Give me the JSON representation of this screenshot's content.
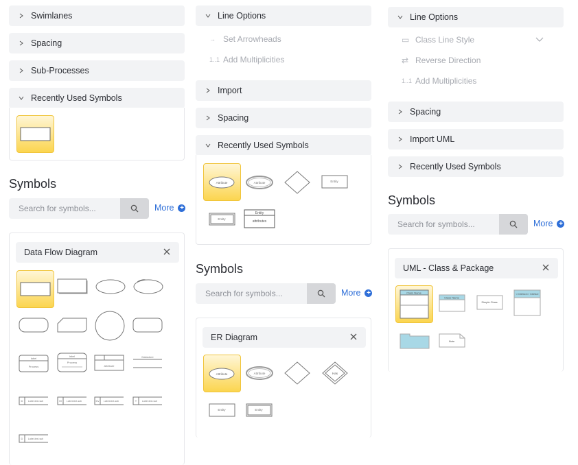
{
  "col1": {
    "sections": [
      "Swimlanes",
      "Spacing",
      "Sub-Processes",
      "Recently Used Symbols"
    ],
    "heading": "Symbols",
    "search_placeholder": "Search for symbols...",
    "more_label": "More",
    "library": "Data Flow Diagram",
    "shape_texts": {
      "label": "label",
      "process": "Process",
      "attribute": "Attribute",
      "datastore": "Datastore",
      "ids": [
        "D",
        "M",
        "T",
        "Dv",
        "D"
      ],
      "subtext": "Label-text-sub"
    }
  },
  "col2": {
    "line_options": "Line Options",
    "sub_items": [
      {
        "icon": "→",
        "label": "Set Arrowheads"
      },
      {
        "icon": "1..1",
        "label": "Add Multiplicities"
      }
    ],
    "sections": [
      "Import",
      "Spacing",
      "Recently Used Symbols"
    ],
    "recent_shape_texts": {
      "attribute": "Attribute",
      "entity": "Entity",
      "attributes": "attributes"
    },
    "heading": "Symbols",
    "search_placeholder": "Search for symbols...",
    "more_label": "More",
    "library": "ER Diagram",
    "er_shape_texts": {
      "attribute": "Attribute",
      "relationship": "Has",
      "entity": "Entity"
    }
  },
  "col3": {
    "line_options": "Line Options",
    "sub_items": [
      {
        "icon": "▭",
        "label": "Class Line Style"
      },
      {
        "icon": "⇄",
        "label": "Reverse Direction"
      },
      {
        "icon": "1..1",
        "label": "Add Multiplicities"
      }
    ],
    "sections": [
      "Spacing",
      "Import UML",
      "Recently Used Symbols"
    ],
    "heading": "Symbols",
    "search_placeholder": "Search for symbols...",
    "more_label": "More",
    "library": "UML - Class & Package",
    "uml_shape_texts": {
      "class_name": "Class Name",
      "simple_class": "Simple Class",
      "interface": "<<Interface>> Interface",
      "note": "Note"
    }
  },
  "colors": {
    "accent": "#2f6fd8",
    "selected": "#fbd54f",
    "header_bg": "#f2f3f5",
    "uml_fill": "#a8d8e6"
  }
}
